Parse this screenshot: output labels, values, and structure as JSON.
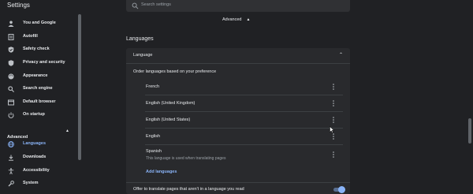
{
  "app": {
    "title": "Settings"
  },
  "search": {
    "placeholder": "Search settings"
  },
  "sidebar": {
    "items": [
      {
        "label": "You and Google",
        "icon": "person-icon"
      },
      {
        "label": "Autofill",
        "icon": "clipboard-icon"
      },
      {
        "label": "Safety check",
        "icon": "shield-check-icon"
      },
      {
        "label": "Privacy and security",
        "icon": "shield-icon"
      },
      {
        "label": "Appearance",
        "icon": "palette-icon"
      },
      {
        "label": "Search engine",
        "icon": "search-icon"
      },
      {
        "label": "Default browser",
        "icon": "browser-icon"
      },
      {
        "label": "On startup",
        "icon": "power-icon"
      }
    ],
    "advanced_label": "Advanced",
    "advanced_items": [
      {
        "label": "Languages",
        "icon": "globe-icon",
        "active": true
      },
      {
        "label": "Downloads",
        "icon": "download-icon"
      },
      {
        "label": "Accessibility",
        "icon": "accessibility-icon"
      },
      {
        "label": "System",
        "icon": "wrench-icon"
      }
    ]
  },
  "main": {
    "advanced_link": "Advanced",
    "section_title": "Languages",
    "card": {
      "header": "Language",
      "order_label": "Order languages based on your preference",
      "languages": [
        {
          "name": "French",
          "note": ""
        },
        {
          "name": "English (United Kingdom)",
          "note": ""
        },
        {
          "name": "English (United States)",
          "note": ""
        },
        {
          "name": "English",
          "note": ""
        },
        {
          "name": "Spanish",
          "note": "This language is used when translating pages"
        }
      ],
      "add_languages": "Add languages",
      "offer_translate": "Offer to translate pages that aren't in a language you read",
      "offer_translate_enabled": true
    }
  },
  "colors": {
    "accent": "#8ab4f8",
    "background": "#202124",
    "card": "#292a2d"
  }
}
